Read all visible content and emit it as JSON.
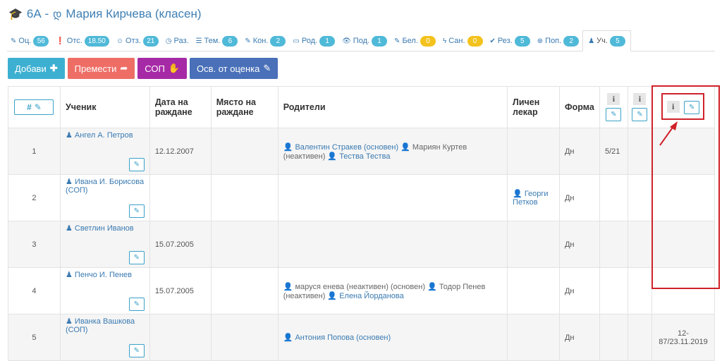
{
  "header": {
    "title": "6А - ",
    "teacher_name": "Мария Кирчева (класен)"
  },
  "tabs": [
    {
      "icon": "✎",
      "label": "Оц.",
      "badge": "56",
      "color": "blue"
    },
    {
      "icon": "❗",
      "label": "Отс.",
      "badge": "18.50",
      "color": "blue"
    },
    {
      "icon": "☺",
      "label": "Отз.",
      "badge": "21",
      "color": "blue"
    },
    {
      "icon": "◷",
      "label": "Раз.",
      "badge": "",
      "color": ""
    },
    {
      "icon": "☰",
      "label": "Тем.",
      "badge": "6",
      "color": "blue"
    },
    {
      "icon": "✎",
      "label": "Кон.",
      "badge": "2",
      "color": "blue"
    },
    {
      "icon": "▭",
      "label": "Род.",
      "badge": "1",
      "color": "blue"
    },
    {
      "icon": "👁",
      "label": "Под.",
      "badge": "1",
      "color": "blue"
    },
    {
      "icon": "✎",
      "label": "Бел.",
      "badge": "0",
      "color": "yellow"
    },
    {
      "icon": "ϟ",
      "label": "Сан.",
      "badge": "0",
      "color": "yellow"
    },
    {
      "icon": "✔",
      "label": "Рез.",
      "badge": "5",
      "color": "blue"
    },
    {
      "icon": "⊕",
      "label": "Поп.",
      "badge": "2",
      "color": "blue"
    },
    {
      "icon": "♟",
      "label": "Уч.",
      "badge": "5",
      "color": "blue",
      "active": true
    }
  ],
  "toolbar": {
    "add": "Добави",
    "move": "Премести",
    "sop": "СОП",
    "exempt": "Осв. от оценка"
  },
  "table": {
    "headers": {
      "hash": "#",
      "student": "Ученик",
      "birth_date": "Дата на раждане",
      "birth_place": "Място на раждане",
      "parents": "Родители",
      "doctor": "Личен лекар",
      "form": "Форма",
      "info": "i"
    },
    "rows": [
      {
        "n": "1",
        "student": "Ангел А. Петров",
        "date": "12.12.2007",
        "parents": [
          {
            "t": "Валентин Стракев (основен)",
            "a": true
          },
          {
            "t": "Мариян Куртев (неактивен)",
            "a": false
          },
          {
            "t": "Тества Тества",
            "a": true
          }
        ],
        "doctor": "",
        "form": "Дн",
        "c1": "5/21",
        "c3": ""
      },
      {
        "n": "2",
        "student": "Ивана И. Борисова (СОП)",
        "date": "",
        "parents": [],
        "doctor": "Георги Петков",
        "form": "Дн",
        "c1": "",
        "c3": ""
      },
      {
        "n": "3",
        "student": "Светлин Иванов",
        "date": "15.07.2005",
        "parents": [],
        "doctor": "",
        "form": "Дн",
        "c1": "",
        "c3": ""
      },
      {
        "n": "4",
        "student": "Пенчо И. Пенев",
        "date": "15.07.2005",
        "parents": [
          {
            "t": "маруся енева (неактивен) (основен)",
            "a": false
          },
          {
            "t": "Тодор Пенев (неактивен)",
            "a": false
          },
          {
            "t": "Елена Йорданова",
            "a": true
          }
        ],
        "doctor": "",
        "form": "Дн",
        "c1": "",
        "c3": ""
      },
      {
        "n": "5",
        "student": "Иванка Вашкова (СОП)",
        "date": "",
        "parents": [
          {
            "t": "Антония Попова (основен)",
            "a": true
          }
        ],
        "doctor": "",
        "form": "Дн",
        "c1": "",
        "c3": "12-87/23.11.2019"
      }
    ]
  },
  "colors": {
    "accent": "#3db0d1",
    "highlight": "#d0222a",
    "link": "#3a7ab1"
  }
}
